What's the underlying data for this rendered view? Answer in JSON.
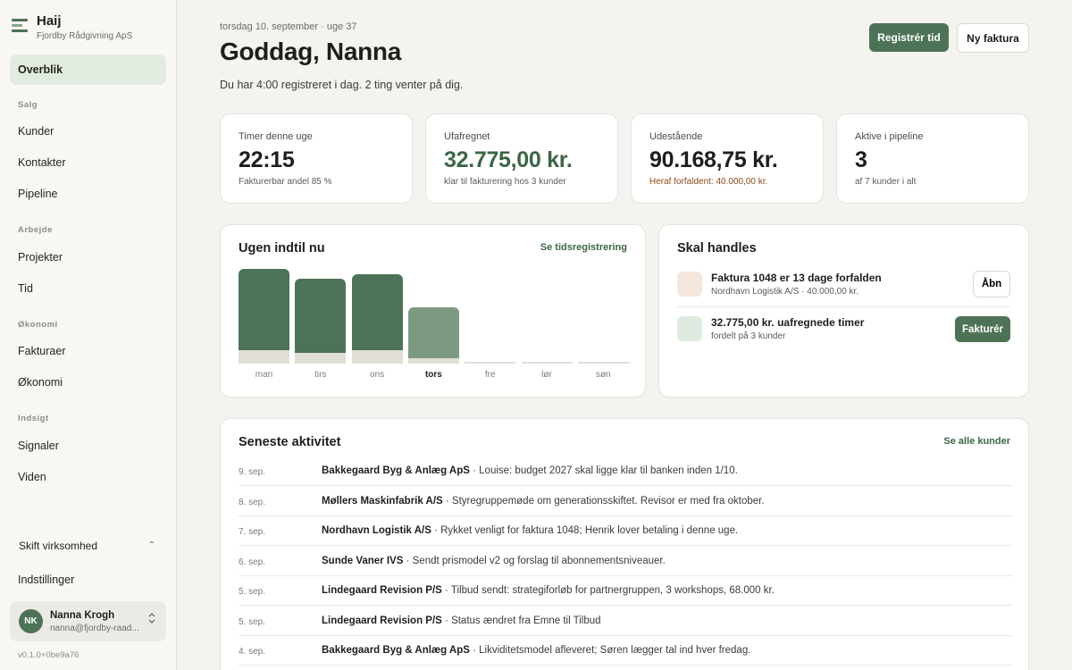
{
  "brand": {
    "name": "Haij",
    "company": "Fjordby Rådgivning ApS",
    "icon": "app-logo-icon"
  },
  "nav": {
    "overview": "Overblik",
    "sections": [
      {
        "title": "Salg",
        "items": [
          "Kunder",
          "Kontakter",
          "Pipeline"
        ]
      },
      {
        "title": "Arbejde",
        "items": [
          "Projekter",
          "Tid"
        ]
      },
      {
        "title": "Økonomi",
        "items": [
          "Fakturaer",
          "Økonomi"
        ]
      },
      {
        "title": "Indsigt",
        "items": [
          "Signaler",
          "Viden"
        ]
      }
    ],
    "switch_label": "Skift virksomhed",
    "settings_label": "Indstillinger"
  },
  "user": {
    "initials": "NK",
    "name": "Nanna Krogh",
    "email": "nanna@fjordby-raad..."
  },
  "version": "v0.1.0+0be9a76",
  "header": {
    "date_line": "torsdag 10. september · uge 37",
    "greeting": "Goddag, Nanna",
    "subtitle": "Du har 4:00 registreret i dag. 2 ting venter på dig.",
    "primary_button": "Registrér tid",
    "secondary_button": "Ny faktura"
  },
  "stats": [
    {
      "label": "Timer denne uge",
      "value": "22:15",
      "note": "Fakturerbar andel 85 %"
    },
    {
      "label": "Ufafregnet",
      "value": "32.775,00 kr.",
      "note": "klar til fakturering hos 3 kunder"
    },
    {
      "label": "Udestående",
      "value": "90.168,75 kr.",
      "note": "Heraf forfaldent: 40.000,00 kr."
    },
    {
      "label": "Aktive i pipeline",
      "value": "3",
      "note": "af 7 kunder i alt"
    }
  ],
  "week": {
    "title": "Ugen indtil nu",
    "link": "Se tidsregistrering",
    "colors": {
      "billable": "#4d7356",
      "today": "#7d9a81",
      "non_billable": "#e1ded6"
    }
  },
  "chart_data": {
    "type": "bar",
    "categories": [
      "man",
      "tirs",
      "ons",
      "tors",
      "fre",
      "lør",
      "søn"
    ],
    "today": "tors",
    "series": [
      {
        "values": [
          5.9,
          5.4,
          5.5,
          3.7,
          0,
          0,
          0
        ]
      },
      {
        "values": [
          1.0,
          0.8,
          1.0,
          0.4,
          0.1,
          0.1,
          0.1
        ]
      }
    ],
    "ylim": [
      0,
      7.5
    ],
    "legend": "none",
    "grid": false
  },
  "actions": {
    "title": "Skal handles",
    "items": [
      {
        "title": "Faktura 1048 er 13 dage forfalden",
        "sub": "Nordhavn Logistik A/S · 40.000,00 kr.",
        "button": "Åbn",
        "color": "#f4e7dd"
      },
      {
        "title": "32.775,00 kr. uafregnede timer",
        "sub": "fordelt på 3 kunder",
        "button": "Fakturér",
        "color": "#dfebdf"
      }
    ]
  },
  "activity": {
    "title": "Seneste aktivitet",
    "link": "Se alle kunder",
    "rows": [
      {
        "date": "9. sep.",
        "company": "Bakkegaard Byg & Anlæg ApS",
        "text": " · Louise: budget 2027 skal ligge klar til banken inden 1/10."
      },
      {
        "date": "8. sep.",
        "company": "Møllers Maskinfabrik A/S",
        "text": " · Styregruppemøde om generationsskiftet. Revisor er med fra oktober."
      },
      {
        "date": "7. sep.",
        "company": "Nordhavn Logistik A/S",
        "text": " · Rykket venligt for faktura 1048; Henrik lover betaling i denne uge."
      },
      {
        "date": "6. sep.",
        "company": "Sunde Vaner IVS",
        "text": " · Sendt prismodel v2 og forslag til abonnementsniveauer."
      },
      {
        "date": "5. sep.",
        "company": "Lindegaard Revision P/S",
        "text": " · Tilbud sendt: strategiforløb for partnergruppen, 3 workshops, 68.000 kr."
      },
      {
        "date": "5. sep.",
        "company": "Lindegaard Revision P/S",
        "text": " · Status ændret fra Emne til Tilbud"
      },
      {
        "date": "4. sep.",
        "company": "Bakkegaard Byg & Anlæg ApS",
        "text": " · Likviditetsmodel afleveret; Søren lægger tal ind hver fredag."
      }
    ]
  }
}
